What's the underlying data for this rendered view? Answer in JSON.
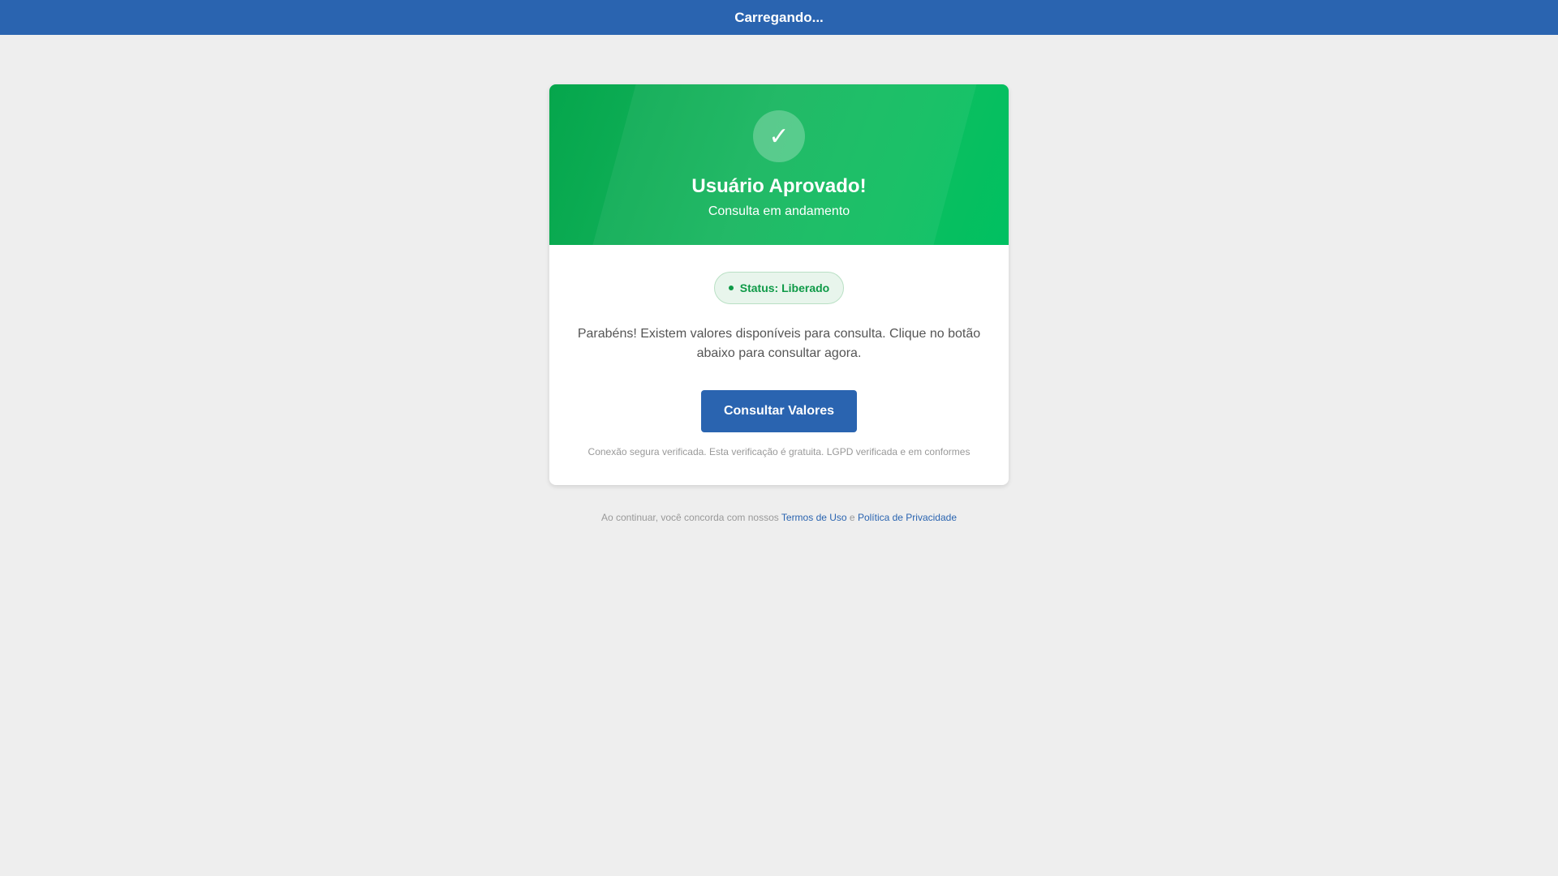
{
  "topbar": {
    "title": "Carregando..."
  },
  "card": {
    "header": {
      "icon": "checkmark-icon",
      "icon_glyph": "✓",
      "title": "Usuário Aprovado!",
      "subtitle": "Consulta em andamento"
    },
    "status": {
      "label": "Status: Liberado"
    },
    "message": "Parabéns! Existem valores disponíveis para consulta. Clique no botão abaixo para consultar agora.",
    "button": {
      "label": "Consultar Valores"
    },
    "secure_note": "Conexão segura verificada. Esta verificação é gratuita. LGPD verificada e em conformes"
  },
  "footer": {
    "prefix": "Ao continuar, você concorda com nossos ",
    "terms_link": "Termos de Uso",
    "conjunction": " e ",
    "privacy_link": "Política de Privacidade"
  },
  "colors": {
    "brand_blue": "#2a64b0",
    "success_green": "#0e9a47",
    "background": "#eeeeee"
  }
}
